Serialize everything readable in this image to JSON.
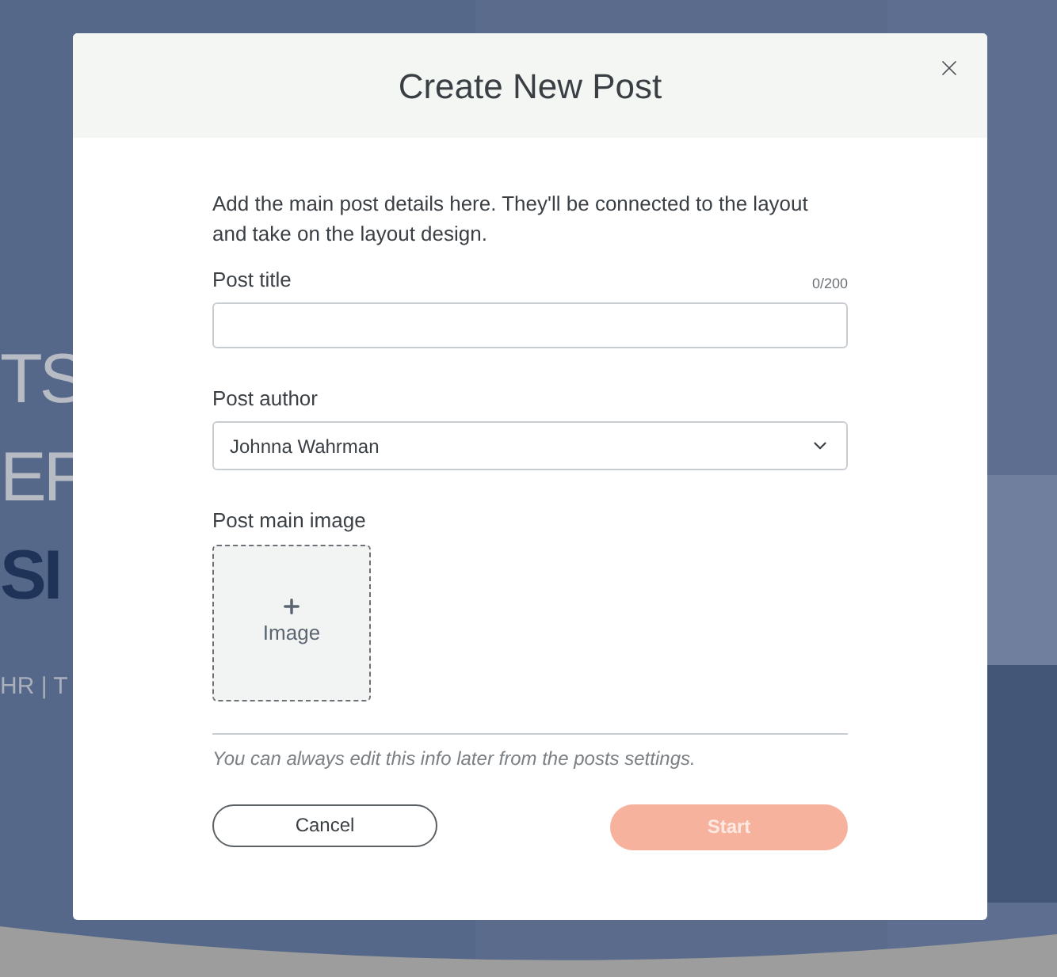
{
  "background": {
    "texts": [
      {
        "text": "TS",
        "kind": "light"
      },
      {
        "text": "EF",
        "kind": "light"
      },
      {
        "text": "SI",
        "kind": "bold"
      },
      {
        "text": "HR | T",
        "kind": "small"
      }
    ]
  },
  "dialog": {
    "title": "Create New Post",
    "intro": "Add the main post details here. They'll be connected to the layout and take on the layout design.",
    "title_field": {
      "label": "Post title",
      "counter": "0/200"
    },
    "author_field": {
      "label": "Post author",
      "value": "Johnna Wahrman"
    },
    "image_field": {
      "label": "Post main image",
      "button": "Image"
    },
    "note": "You can always edit this info later from the posts settings.",
    "buttons": [
      {
        "label": "Cancel",
        "kind": "secondary",
        "disabled": false
      },
      {
        "label": "Start",
        "kind": "primary",
        "disabled": true
      }
    ]
  }
}
